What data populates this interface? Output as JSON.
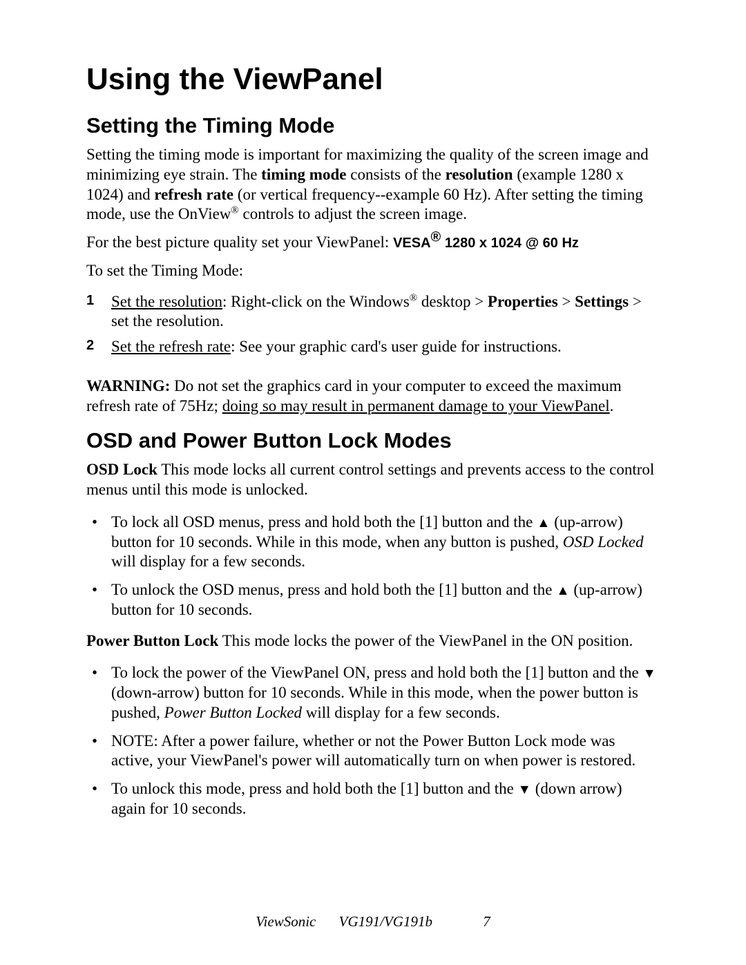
{
  "title": "Using the ViewPanel",
  "section1": {
    "heading": "Setting the Timing Mode",
    "para1_a": "Setting the timing mode is important for maximizing the quality of the screen image and minimizing eye strain. The ",
    "para1_b_bold": "timing mode",
    "para1_c": " consists of the ",
    "para1_d_bold": "resolution",
    "para1_e": " (example 1280 x 1024) and ",
    "para1_f_bold": "refresh rate",
    "para1_g": " (or vertical frequency--example 60 Hz). After setting the timing mode, use the OnView",
    "para1_h_reg": "®",
    "para1_i": " controls  to adjust the screen image.",
    "para2_a": "For the best picture quality set your ViewPanel: ",
    "para2_b_sans": "VESA",
    "para2_c_sup": "®",
    "para2_d_sans": " 1280 x 1024 @ 60 Hz",
    "para3": "To set the Timing Mode:",
    "steps": [
      {
        "num": "1",
        "a_u": "Set the resolution",
        "b": ": Right-click on the Windows",
        "c_reg": "®",
        "d": " desktop > ",
        "e_bold": "Properties",
        "f": " > ",
        "g_bold": "Settings",
        "h": " > set the resolution."
      },
      {
        "num": "2",
        "a_u": "Set the refresh rate",
        "b": ": See your graphic card's user guide for instructions."
      }
    ],
    "warn_a_bold": "WARNING:",
    "warn_b": " Do not set the graphics card in your computer to exceed the maximum refresh rate of 75Hz; ",
    "warn_c_u": "doing so may result in permanent damage to your ViewPanel",
    "warn_d": "."
  },
  "section2": {
    "heading": "OSD and Power Button Lock Modes",
    "osd_a_bold": "OSD Lock",
    "osd_b": " This mode locks all current control settings and prevents access to the control menus until this mode is unlocked.",
    "osd_bullets": [
      {
        "a": "To lock all OSD menus, press and hold both the [1] button and the ",
        "arrow": "▲",
        "b": " (up-arrow) button for 10 seconds. While in this mode, when any button is pushed, ",
        "c_italic": "OSD Locked",
        "d": " will display for a few seconds."
      },
      {
        "a": "To unlock the OSD menus, press and hold both the [1] button and the ",
        "arrow": "▲",
        "b": " (up-arrow) button for 10 seconds."
      }
    ],
    "pbl_a_bold": "Power Button Lock",
    "pbl_b": " This mode locks the power of the ViewPanel in the ON position.",
    "pbl_bullets": [
      {
        "a": "To lock the power of the ViewPanel ON, press and hold both the [1] button and the ",
        "arrow": "▼",
        "b": " (down-arrow) button for 10 seconds. While in this mode, when the power button is pushed, ",
        "c_italic": "Power Button Locked",
        "d": " will display for a few seconds."
      },
      {
        "a": "NOTE: After a power failure, whether or not the Power Button Lock mode was active, your ViewPanel's power will automatically turn on when power is restored."
      },
      {
        "a": "To unlock this mode, press and hold both the [1] button and the  ",
        "arrow": "▼",
        "b": " (down arrow) again for 10 seconds."
      }
    ]
  },
  "footer": {
    "company": "ViewSonic",
    "model": "VG191/VG191b",
    "page": "7"
  }
}
